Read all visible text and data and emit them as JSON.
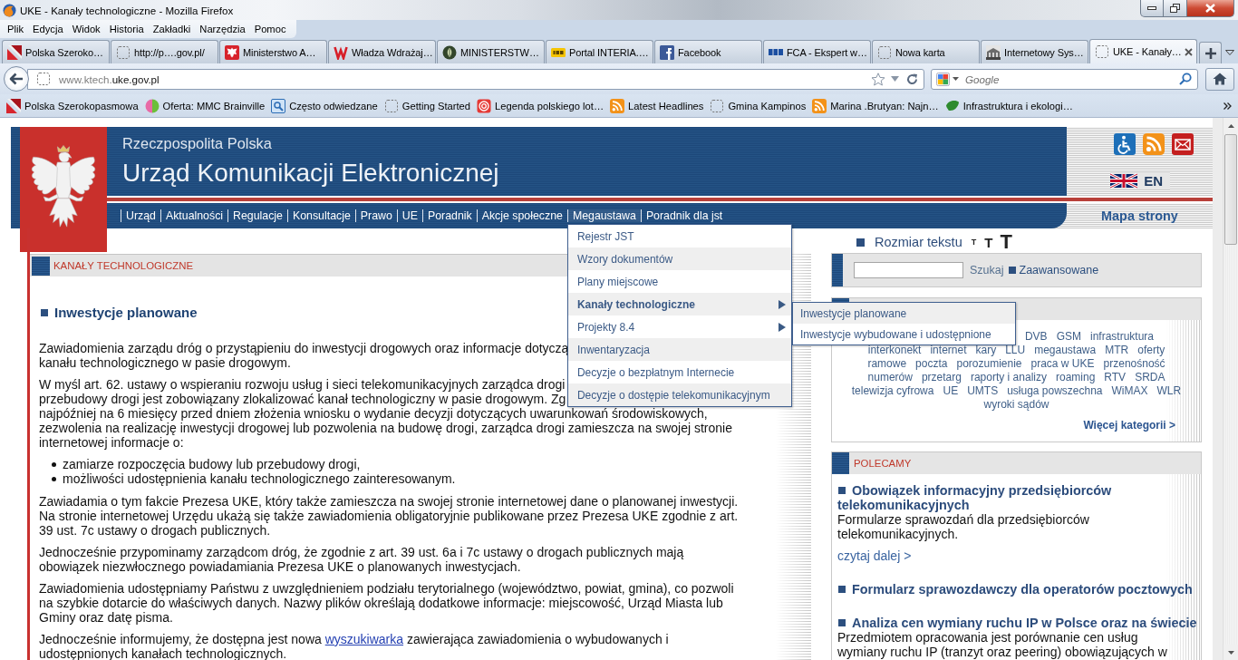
{
  "window": {
    "title": "UKE - Kanały technologiczne - Mozilla Firefox"
  },
  "menu_bar": [
    "Plik",
    "Edycja",
    "Widok",
    "Historia",
    "Zakładki",
    "Narzędzia",
    "Pomoc"
  ],
  "tabs": [
    {
      "title": "Polska Szeroko…",
      "selected": false
    },
    {
      "title": "http://p….gov.pl/",
      "selected": false
    },
    {
      "title": "Ministerstwo A…",
      "selected": false
    },
    {
      "title": "Władza Wdrażaj…",
      "selected": false
    },
    {
      "title": "MINISTERSTW…",
      "selected": false
    },
    {
      "title": "Portal INTERIA.…",
      "selected": false
    },
    {
      "title": "Facebook",
      "selected": false
    },
    {
      "title": "FCA - Ekspert w…",
      "selected": false
    },
    {
      "title": "Nowa karta",
      "selected": false
    },
    {
      "title": "Internetowy Sys…",
      "selected": false
    },
    {
      "title": "UKE - Kanały…",
      "selected": true
    }
  ],
  "address_bar": {
    "subdomain": "www.ktech.",
    "domain": "uke.gov.pl"
  },
  "search_bar": {
    "placeholder": "Google"
  },
  "bookmarks": [
    "Polska Szerokopasmowa",
    "Oferta: MMC Brainville",
    "Często odwiedzane",
    "Getting Started",
    "Legenda polskiego lot…",
    "Latest Headlines",
    "Gmina Kampinos",
    "Marina .Brutyan: Najn…",
    "Infrastruktura i ekologi…"
  ],
  "site": {
    "header": {
      "subtitle": "Rzeczpospolita Polska",
      "title": "Urząd Komunikacji Elektronicznej",
      "language": "EN"
    },
    "nav": [
      {
        "label": "Urząd",
        "expanded": false
      },
      {
        "label": "Aktualności",
        "expanded": false
      },
      {
        "label": "Regulacje",
        "expanded": false
      },
      {
        "label": "Konsultacje",
        "expanded": false
      },
      {
        "label": "Prawo",
        "expanded": false
      },
      {
        "label": "UE",
        "expanded": false
      },
      {
        "label": "Poradnik",
        "expanded": false
      },
      {
        "label": "Akcje społeczne",
        "expanded": false
      },
      {
        "label": "Megaustawa",
        "expanded": true,
        "menu": [
          {
            "label": "Rejestr JST",
            "selected": false,
            "has_submenu": false
          },
          {
            "label": "Wzory dokumentów",
            "selected": false,
            "has_submenu": false
          },
          {
            "label": "Plany miejscowe",
            "selected": false,
            "has_submenu": false
          },
          {
            "label": "Kanały technologiczne",
            "selected": true,
            "has_submenu": true,
            "submenu": [
              {
                "label": "Inwestycje planowane",
                "selected": true
              },
              {
                "label": "Inwestycje wybudowane i udostępnione",
                "selected": false
              }
            ]
          },
          {
            "label": "Projekty 8.4",
            "selected": false,
            "has_submenu": true
          },
          {
            "label": "Inwentaryzacja",
            "selected": false,
            "has_submenu": false
          },
          {
            "label": "Decyzje o bezpłatnym Internecie",
            "selected": false,
            "has_submenu": false
          },
          {
            "label": "Decyzje o dostępie telekomunikacyjnym",
            "selected": false,
            "has_submenu": false
          }
        ]
      },
      {
        "label": "Poradnik dla jst",
        "expanded": false
      }
    ],
    "site_map": "Mapa strony",
    "article": {
      "section": "KANAŁY TECHNOLOGICZNE",
      "heading": "Inwestycje planowane",
      "blocks": [
        {
          "kind": "paragraph",
          "segments": [
            {
              "kind": "text",
              "text": "Zawiadomienia zarządu dróg o przystąpieniu do inwestycji drogowych oraz informacje dotyczą\nkanału technologicznego w pasie drogowym."
            }
          ]
        },
        {
          "kind": "paragraph",
          "segments": [
            {
              "kind": "text",
              "text": "W myśl art. 62. ustawy o wspieraniu rozwoju usług i sieci telekomunikacyjnych zarządca drogi\nprzebudowy drogi jest zobowiązany zlokalizować kanał technologiczny w pasie drogowym. Zg"
            }
          ]
        },
        {
          "kind": "continuation",
          "segments": [
            {
              "kind": "text",
              "text": "najpóźniej na 6 miesięcy przed dniem złożenia wniosku o wydanie decyzji dotyczących uwarunkowań środowiskowych,\nzezwolenia na realizację inwestycji drogowej lub pozwolenia na budowę drogi, zarządca drogi zamieszcza na swojej stronie\ninternetowej informacje o:"
            }
          ]
        },
        {
          "kind": "list",
          "items": [
            "zamiarze rozpoczęcia budowy lub przebudowy drogi,",
            "możliwości udostępnienia kanału technologicznego zainteresowanym."
          ]
        },
        {
          "kind": "paragraph",
          "segments": [
            {
              "kind": "text",
              "text": "Zawiadamia o tym fakcie Prezesa UKE, który także zamieszcza na swojej stronie internetowej dane o planowanej inwestycji.\nNa stronie internetowej Urzędu ukażą się także zawiadomienia obligatoryjnie publikowane przez Prezesa UKE zgodnie z art.\n39 ust. 7c ustawy o drogach publicznych."
            }
          ]
        },
        {
          "kind": "paragraph",
          "segments": [
            {
              "kind": "text",
              "text": "Jednocześnie przypominamy zarządcom dróg, że zgodnie z art. 39 ust. 6a i 7c ustawy o drogach publicznych mają\nobowiązek niezwłocznego powiadamiania Prezesa UKE o planowanych inwestycjach."
            }
          ]
        },
        {
          "kind": "paragraph",
          "segments": [
            {
              "kind": "text",
              "text": "Zawiadomienia udostępniamy Państwu z uwzględnieniem podziału terytorialnego (województwo, powiat, gmina), co pozwoli\nna szybkie dotarcie do właściwych danych. Nazwy plików określają dodatkowe informacje: miejscowość, Urząd Miasta lub\nGminy oraz datę pisma."
            }
          ]
        },
        {
          "kind": "paragraph",
          "segments": [
            {
              "kind": "text",
              "text": "Jednocześnie informujemy, że dostępna jest nowa "
            },
            {
              "kind": "link",
              "text": "wyszukiwarka"
            },
            {
              "kind": "text",
              "text": " zawierająca zawiadomienia o wybudowanych i\nudostępnionych kanałach technologicznych."
            }
          ]
        }
      ]
    },
    "sidebar": {
      "text_size": {
        "label": "Rozmiar tekstu",
        "options": [
          {
            "label": "T",
            "kind": "small"
          },
          {
            "label": "T",
            "kind": "medium"
          },
          {
            "label": "T",
            "kind": "large"
          }
        ]
      },
      "search": {
        "button": "Szukaj",
        "advanced": "Zaawansowane"
      },
      "tags": {
        "lines": [
          [
            "DVB",
            "GSM",
            "infrastruktura"
          ],
          [
            "interkonekt",
            "internet",
            "kary",
            "LLU",
            "megaustawa",
            "MTR",
            "oferty"
          ],
          [
            "ramowe",
            "poczta",
            "porozumienie",
            "praca w UKE",
            "przenośność"
          ],
          [
            "numerów",
            "przetarg",
            "raporty i analizy",
            "roaming",
            "RTV",
            "SRDA"
          ],
          [
            "telewizja cyfrowa",
            "UE",
            "UMTS",
            "usługa powszechna",
            "WiMAX",
            "WLR"
          ],
          [
            "wyroki sądów"
          ]
        ],
        "more": "Więcej kategorii >"
      },
      "recommended": {
        "title": "POLECAMY",
        "items": [
          {
            "title": "Obowiązek informacyjny przedsiębiorców\ntelekomunikacyjnych",
            "description": "Formularze sprawozdań dla przedsiębiorców\ntelekomunikacyjnych.",
            "more": "czytaj dalej >"
          },
          {
            "title": "Formularz sprawozdawczy dla operatorów pocztowych"
          },
          {
            "title": "Analiza cen wymiany ruchu IP w Polsce oraz na świecie",
            "description": "Przedmiotem opracowania jest porównanie cen usług\nwymiany ruchu IP (tranzyt oraz peering) obowiązujących w"
          }
        ]
      }
    }
  }
}
